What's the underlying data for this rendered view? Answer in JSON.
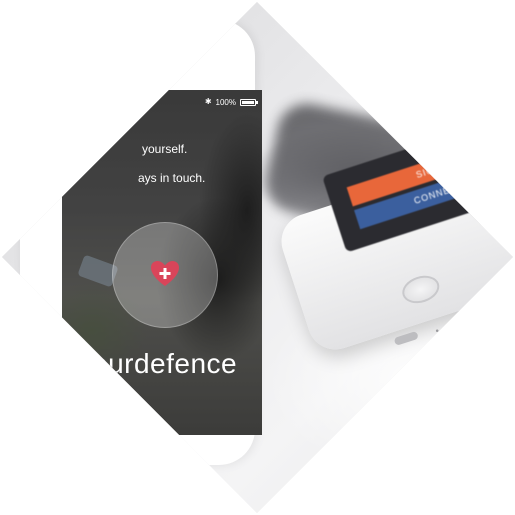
{
  "status_bar": {
    "battery_percent": "100%"
  },
  "screen": {
    "line1": "yourself.",
    "line2": "ays in touch.",
    "brand": "ourdefence"
  },
  "second_phone": {
    "signup_label": "SIGN UP W",
    "connect_label": "CONNECT WITH F"
  },
  "colors": {
    "heart": "#d9455a",
    "signup_button": "#e8673a",
    "connect_button": "#3b5f9e",
    "frame": "#ffffff"
  },
  "icons": [
    "bluetooth-icon",
    "battery-icon",
    "heart-plus-icon",
    "home-button-icon"
  ]
}
